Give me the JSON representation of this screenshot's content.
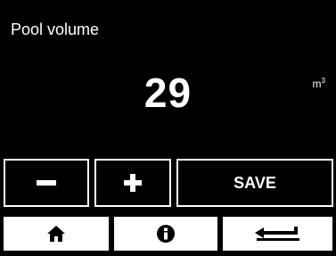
{
  "screen": {
    "title": "Pool volume",
    "value": "29",
    "unit": "m",
    "unit_superscript": "3"
  },
  "controls": {
    "decrement_icon": "minus-icon",
    "increment_icon": "plus-icon",
    "save_label": "SAVE"
  },
  "navbar": {
    "home_icon": "home-icon",
    "info_icon": "info-icon",
    "back_icon": "return-arrow-icon"
  },
  "colors": {
    "background": "#000000",
    "foreground": "#ffffff"
  }
}
